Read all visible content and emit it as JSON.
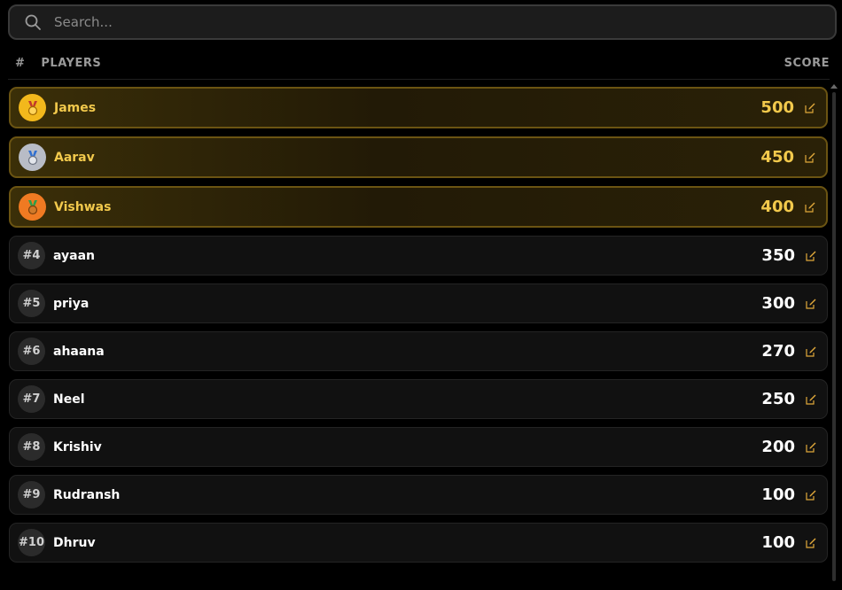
{
  "search": {
    "placeholder": "Search..."
  },
  "header": {
    "hash": "#",
    "players": "PLAYERS",
    "score": "SCORE"
  },
  "colors": {
    "gold": "#f2c94c",
    "silver": "#b8bcc6",
    "bronze": "#f07a22",
    "edit": "#e0a83a"
  },
  "top_players": [
    {
      "name": "James",
      "score": "500",
      "medal": "gold-medal-icon"
    },
    {
      "name": "Aarav",
      "score": "450",
      "medal": "silver-medal-icon"
    },
    {
      "name": "Vishwas",
      "score": "400",
      "medal": "bronze-medal-icon"
    }
  ],
  "players": [
    {
      "rank": "#4",
      "name": "ayaan",
      "score": "350"
    },
    {
      "rank": "#5",
      "name": "priya",
      "score": "300"
    },
    {
      "rank": "#6",
      "name": "ahaana",
      "score": "270"
    },
    {
      "rank": "#7",
      "name": "Neel",
      "score": "250"
    },
    {
      "rank": "#8",
      "name": "Krishiv",
      "score": "200"
    },
    {
      "rank": "#9",
      "name": "Rudransh",
      "score": "100"
    },
    {
      "rank": "#10",
      "name": "Dhruv",
      "score": "100"
    }
  ]
}
